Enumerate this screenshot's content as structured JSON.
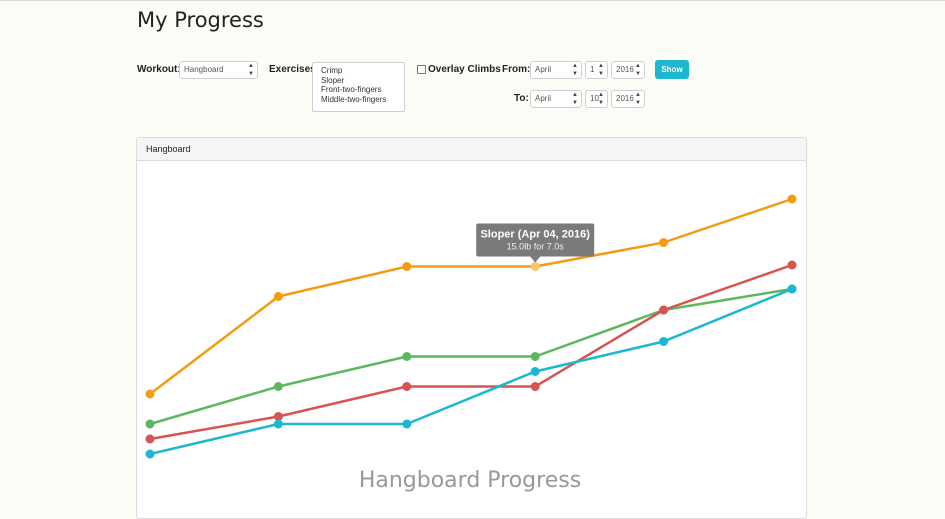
{
  "page": {
    "title": "My Progress"
  },
  "controls": {
    "workout_label": "Workout:",
    "workout_value": "Hangboard",
    "exercises_label": "Exercises:",
    "exercises": [
      "Crimp",
      "Sloper",
      "Front-two-fingers",
      "Middle-two-fingers"
    ],
    "overlay_label": "Overlay Climbs",
    "overlay_checked": false,
    "from_label": "From:",
    "from_month": "April",
    "from_day": "1",
    "from_year": "2016",
    "to_label": "To:",
    "to_month": "April",
    "to_day": "10",
    "to_year": "2016",
    "show_button": "Show"
  },
  "panel": {
    "title": "Hangboard"
  },
  "chart_data": {
    "type": "line",
    "title": "Hangboard Progress",
    "x": [
      1,
      2,
      3,
      4,
      5,
      6
    ],
    "series": [
      {
        "color": "#f39c12",
        "values": [
          6.4,
          12.9,
          14.9,
          14.9,
          16.5,
          19.4
        ]
      },
      {
        "color": "#5cb85c",
        "values": [
          4.4,
          6.9,
          8.9,
          8.9,
          12.0,
          13.4
        ]
      },
      {
        "color": "#d9534f",
        "values": [
          3.4,
          4.9,
          6.9,
          6.9,
          12.0,
          15.0
        ]
      },
      {
        "color": "#1bb8cf",
        "values": [
          2.4,
          4.4,
          4.4,
          7.9,
          9.9,
          13.4
        ]
      }
    ],
    "ylim": [
      0,
      22
    ],
    "grid": false,
    "tooltip": {
      "series_index": 0,
      "point_index": 3,
      "title": "Sloper (Apr 04, 2016)",
      "detail": "15.0lb for 7.0s"
    }
  }
}
